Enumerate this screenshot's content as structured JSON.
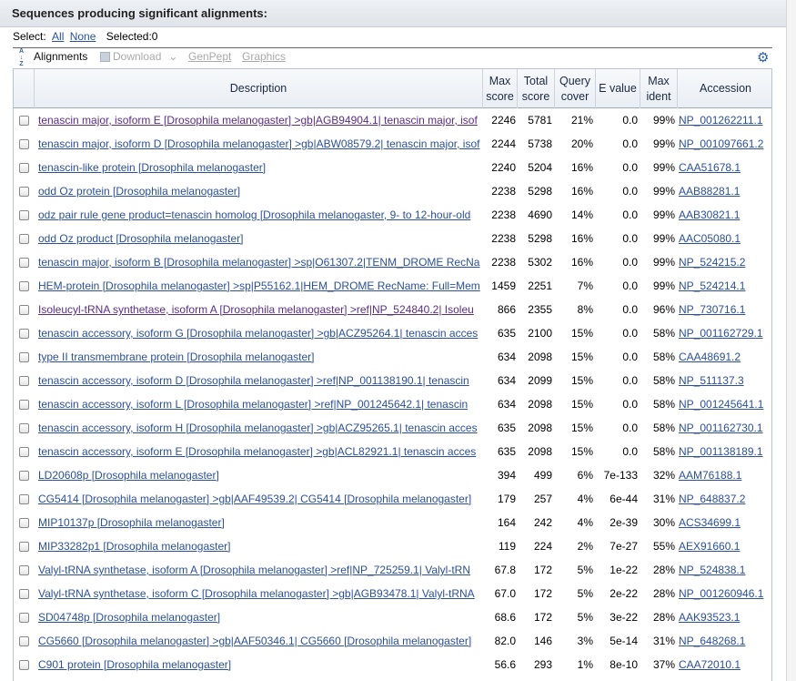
{
  "section": {
    "title": "Sequences producing significant alignments:"
  },
  "select": {
    "label": "Select:",
    "all": "All",
    "none": "None",
    "selected": "Selected:0"
  },
  "toolbar": {
    "alignments": "Alignments",
    "download": "Download",
    "download_caret": "⌄",
    "genpept": "GenPept",
    "graphics": "Graphics",
    "gear_icon": "⚙"
  },
  "columns": {
    "description": "Description",
    "max_score": "Max score",
    "total_score": "Total score",
    "query_cover": "Query cover",
    "e_value": "E value",
    "max_ident": "Max ident",
    "accession": "Accession"
  },
  "rows": [
    {
      "desc": "tenascin major, isoform E [Drosophila melanogaster] >gb|AGB94904.1| tenascin major, isof",
      "max": "2246",
      "total": "5781",
      "cover": "21%",
      "e": "0.0",
      "ident": "99%",
      "acc": "NP_001262211.1",
      "visited": true
    },
    {
      "desc": "tenascin major, isoform D [Drosophila melanogaster] >gb|ABW08579.2| tenascin major, isof",
      "max": "2244",
      "total": "5738",
      "cover": "20%",
      "e": "0.0",
      "ident": "99%",
      "acc": "NP_001097661.2",
      "visited": false
    },
    {
      "desc": "tenascin-like protein [Drosophila melanogaster]",
      "max": "2240",
      "total": "5204",
      "cover": "16%",
      "e": "0.0",
      "ident": "99%",
      "acc": "CAA51678.1",
      "visited": false
    },
    {
      "desc": "odd Oz protein [Drosophila melanogaster]",
      "max": "2238",
      "total": "5298",
      "cover": "16%",
      "e": "0.0",
      "ident": "99%",
      "acc": "AAB88281.1",
      "visited": false
    },
    {
      "desc": "odz pair rule gene product=tenascin homolog [Drosophila melanogaster, 9- to 12-hour-old",
      "max": "2238",
      "total": "4690",
      "cover": "14%",
      "e": "0.0",
      "ident": "99%",
      "acc": "AAB30821.1",
      "visited": false
    },
    {
      "desc": "odd Oz product [Drosophila melanogaster]",
      "max": "2238",
      "total": "5298",
      "cover": "16%",
      "e": "0.0",
      "ident": "99%",
      "acc": "AAC05080.1",
      "visited": false
    },
    {
      "desc": "tenascin major, isoform B [Drosophila melanogaster] >sp|O61307.2|TENM_DROME RecNa",
      "max": "2238",
      "total": "5302",
      "cover": "16%",
      "e": "0.0",
      "ident": "99%",
      "acc": "NP_524215.2",
      "visited": false
    },
    {
      "desc": "HEM-protein [Drosophila melanogaster] >sp|P55162.1|HEM_DROME RecName: Full=Mem",
      "max": "1459",
      "total": "2251",
      "cover": "7%",
      "e": "0.0",
      "ident": "99%",
      "acc": "NP_524214.1",
      "visited": false
    },
    {
      "desc": "Isoleucyl-tRNA synthetase, isoform A [Drosophila melanogaster] >ref|NP_524840.2| Isoleu",
      "max": "866",
      "total": "2355",
      "cover": "8%",
      "e": "0.0",
      "ident": "96%",
      "acc": "NP_730716.1",
      "visited": true
    },
    {
      "desc": "tenascin accessory, isoform G [Drosophila melanogaster] >gb|ACZ95264.1| tenascin acces",
      "max": "635",
      "total": "2100",
      "cover": "15%",
      "e": "0.0",
      "ident": "58%",
      "acc": "NP_001162729.1",
      "visited": false
    },
    {
      "desc": "type II transmembrane protein [Drosophila melanogaster]",
      "max": "634",
      "total": "2098",
      "cover": "15%",
      "e": "0.0",
      "ident": "58%",
      "acc": "CAA48691.2",
      "visited": false
    },
    {
      "desc": "tenascin accessory, isoform D [Drosophila melanogaster] >ref|NP_001138190.1| tenascin",
      "max": "634",
      "total": "2099",
      "cover": "15%",
      "e": "0.0",
      "ident": "58%",
      "acc": "NP_511137.3",
      "visited": false
    },
    {
      "desc": "tenascin accessory, isoform L [Drosophila melanogaster] >ref|NP_001245642.1| tenascin",
      "max": "634",
      "total": "2098",
      "cover": "15%",
      "e": "0.0",
      "ident": "58%",
      "acc": "NP_001245641.1",
      "visited": false
    },
    {
      "desc": "tenascin accessory, isoform H [Drosophila melanogaster] >gb|ACZ95265.1| tenascin acces",
      "max": "635",
      "total": "2098",
      "cover": "15%",
      "e": "0.0",
      "ident": "58%",
      "acc": "NP_001162730.1",
      "visited": false
    },
    {
      "desc": "tenascin accessory, isoform E [Drosophila melanogaster] >gb|ACL82921.1| tenascin acces",
      "max": "635",
      "total": "2098",
      "cover": "15%",
      "e": "0.0",
      "ident": "58%",
      "acc": "NP_001138189.1",
      "visited": false
    },
    {
      "desc": "LD20608p [Drosophila melanogaster]",
      "max": "394",
      "total": "499",
      "cover": "6%",
      "e": "7e-133",
      "ident": "32%",
      "acc": "AAM76188.1",
      "visited": false
    },
    {
      "desc": "CG5414 [Drosophila melanogaster] >gb|AAF49539.2| CG5414 [Drosophila melanogaster]",
      "max": "179",
      "total": "257",
      "cover": "4%",
      "e": "6e-44",
      "ident": "31%",
      "acc": "NP_648837.2",
      "visited": false
    },
    {
      "desc": "MIP10137p [Drosophila melanogaster]",
      "max": "164",
      "total": "242",
      "cover": "4%",
      "e": "2e-39",
      "ident": "30%",
      "acc": "ACS34699.1",
      "visited": false
    },
    {
      "desc": "MIP33282p1 [Drosophila melanogaster]",
      "max": "119",
      "total": "224",
      "cover": "2%",
      "e": "7e-27",
      "ident": "55%",
      "acc": "AEX91660.1",
      "visited": false
    },
    {
      "desc": "Valyl-tRNA synthetase, isoform A [Drosophila melanogaster] >ref|NP_725259.1| Valyl-tRN",
      "max": "67.8",
      "total": "172",
      "cover": "5%",
      "e": "1e-22",
      "ident": "28%",
      "acc": "NP_524838.1",
      "visited": false
    },
    {
      "desc": "Valyl-tRNA synthetase, isoform C [Drosophila melanogaster] >gb|AGB93478.1| Valyl-tRNA",
      "max": "67.0",
      "total": "172",
      "cover": "5%",
      "e": "2e-22",
      "ident": "28%",
      "acc": "NP_001260946.1",
      "visited": false
    },
    {
      "desc": "SD04748p [Drosophila melanogaster]",
      "max": "68.6",
      "total": "172",
      "cover": "5%",
      "e": "3e-22",
      "ident": "28%",
      "acc": "AAK93523.1",
      "visited": false
    },
    {
      "desc": "CG5660 [Drosophila melanogaster] >gb|AAF50346.1| CG5660 [Drosophila melanogaster]",
      "max": "82.0",
      "total": "146",
      "cover": "3%",
      "e": "5e-14",
      "ident": "31%",
      "acc": "NP_648268.1",
      "visited": false
    },
    {
      "desc": "C901 protein [Drosophila melanogaster]",
      "max": "56.6",
      "total": "293",
      "cover": "1%",
      "e": "8e-10",
      "ident": "37%",
      "acc": "CAA72010.1",
      "visited": false
    }
  ]
}
